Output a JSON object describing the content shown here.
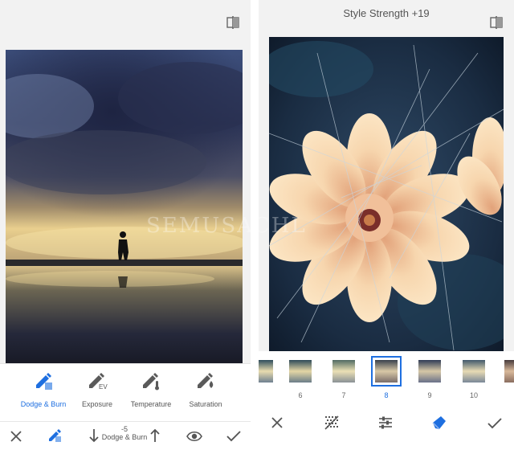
{
  "left_panel": {
    "tools": [
      {
        "label": "Dodge & Burn",
        "icon": "dodge-burn-icon",
        "active": true
      },
      {
        "label": "Exposure",
        "icon": "exposure-icon",
        "badge": "EV"
      },
      {
        "label": "Temperature",
        "icon": "temperature-icon"
      },
      {
        "label": "Saturation",
        "icon": "saturation-icon"
      }
    ],
    "stepper": {
      "value": "-5",
      "label": "Dodge & Burn"
    },
    "bottom_icons": [
      "close-icon",
      "brush-icon",
      "arrow-down-icon",
      "arrow-up-icon",
      "eye-icon",
      "check-icon"
    ]
  },
  "right_panel": {
    "title": "Style Strength +19",
    "thumbnails": [
      {
        "label": "6"
      },
      {
        "label": "7"
      },
      {
        "label": "8",
        "selected": true
      },
      {
        "label": "9"
      },
      {
        "label": "10"
      }
    ],
    "bottom_icons": [
      "close-icon",
      "texture-icon",
      "sliders-icon",
      "style-brush-icon",
      "check-icon"
    ]
  },
  "watermark": "SEMUSACHL",
  "colors": {
    "accent": "#1e6fe0",
    "icon": "#5a5a5a",
    "background": "#f2f2f2"
  }
}
